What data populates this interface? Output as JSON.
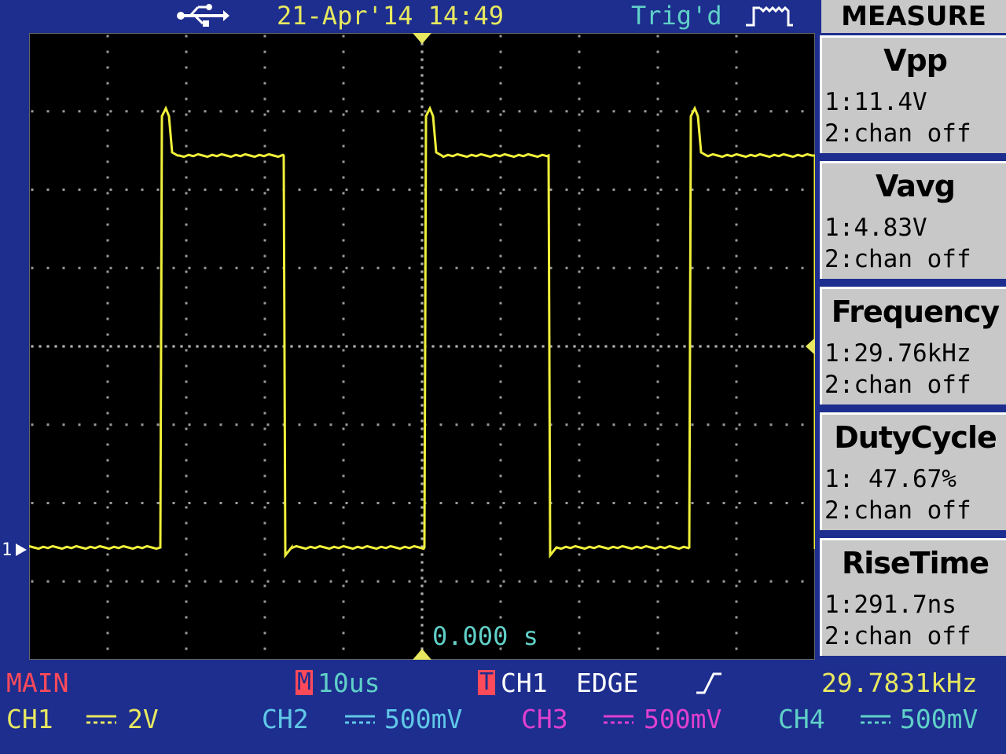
{
  "header": {
    "usb_icon": "usb-icon",
    "datetime": "21-Apr'14 14:49",
    "trigger_status": "Trig'd",
    "trigger_icon": "acquisition-waveform-icon"
  },
  "measure": {
    "title": "MEASURE",
    "items": [
      {
        "name": "Vpp",
        "ch1": "1:11.4V",
        "ch2": "2:chan off"
      },
      {
        "name": "Vavg",
        "ch1": "1:4.83V",
        "ch2": "2:chan off"
      },
      {
        "name": "Frequency",
        "ch1": "1:29.76kHz",
        "ch2": "2:chan off"
      },
      {
        "name": "DutyCycle",
        "ch1": "1: 47.67%",
        "ch2": "2:chan off"
      },
      {
        "name": "RiseTime",
        "ch1": "1:291.7ns",
        "ch2": "2:chan off"
      }
    ]
  },
  "screen": {
    "ch1_marker": "1",
    "time_position": "0.000 s"
  },
  "status": {
    "mode": "MAIN",
    "m_badge": "M",
    "timebase": "10us",
    "t_badge": "T",
    "trigger_source": "CH1",
    "trigger_type": "EDGE",
    "slope_icon": "rising-edge-icon",
    "trigger_frequency": "29.7831kHz"
  },
  "channels": [
    {
      "label": "CH1",
      "scale": "2V",
      "color": "#e8e860"
    },
    {
      "label": "CH2",
      "scale": "500mV",
      "color": "#60c8e8"
    },
    {
      "label": "CH3",
      "scale": "500mV",
      "color": "#e040d0"
    },
    {
      "label": "CH4",
      "scale": "500mV",
      "color": "#60d0c8"
    }
  ],
  "colors": {
    "frame": "#1d2e8e",
    "ch1_trace": "#f0f03a",
    "panel": "#c8c8c8",
    "cyan_text": "#60d0c8"
  }
}
